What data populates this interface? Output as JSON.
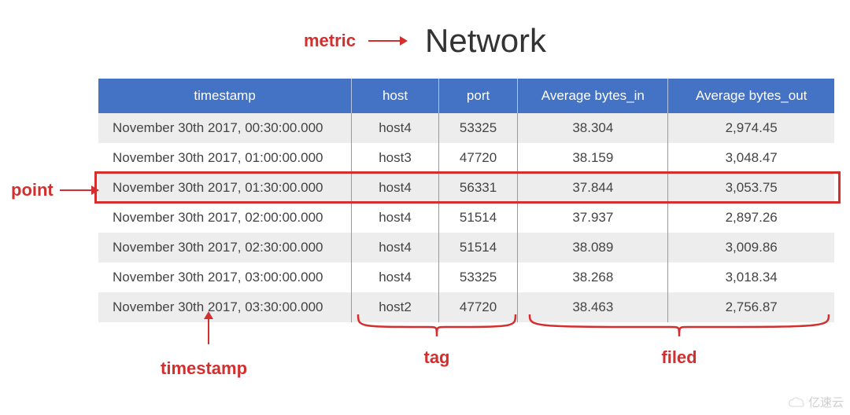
{
  "annotations": {
    "metric": "metric",
    "title": "Network",
    "point": "point",
    "timestamp": "timestamp",
    "tag": "tag",
    "filed": "filed"
  },
  "table": {
    "headers": {
      "timestamp": "timestamp",
      "host": "host",
      "port": "port",
      "avg_in": "Average bytes_in",
      "avg_out": "Average bytes_out"
    },
    "rows": [
      {
        "timestamp": "November 30th 2017, 00:30:00.000",
        "host": "host4",
        "port": "53325",
        "avg_in": "38.304",
        "avg_out": "2,974.45"
      },
      {
        "timestamp": "November 30th 2017, 01:00:00.000",
        "host": "host3",
        "port": "47720",
        "avg_in": "38.159",
        "avg_out": "3,048.47"
      },
      {
        "timestamp": "November 30th 2017, 01:30:00.000",
        "host": "host4",
        "port": "56331",
        "avg_in": "37.844",
        "avg_out": "3,053.75"
      },
      {
        "timestamp": "November 30th 2017, 02:00:00.000",
        "host": "host4",
        "port": "51514",
        "avg_in": "37.937",
        "avg_out": "2,897.26"
      },
      {
        "timestamp": "November 30th 2017, 02:30:00.000",
        "host": "host4",
        "port": "51514",
        "avg_in": "38.089",
        "avg_out": "3,009.86"
      },
      {
        "timestamp": "November 30th 2017, 03:00:00.000",
        "host": "host4",
        "port": "53325",
        "avg_in": "38.268",
        "avg_out": "3,018.34"
      },
      {
        "timestamp": "November 30th 2017, 03:30:00.000",
        "host": "host2",
        "port": "47720",
        "avg_in": "38.463",
        "avg_out": "2,756.87"
      }
    ]
  },
  "watermark": "亿速云"
}
